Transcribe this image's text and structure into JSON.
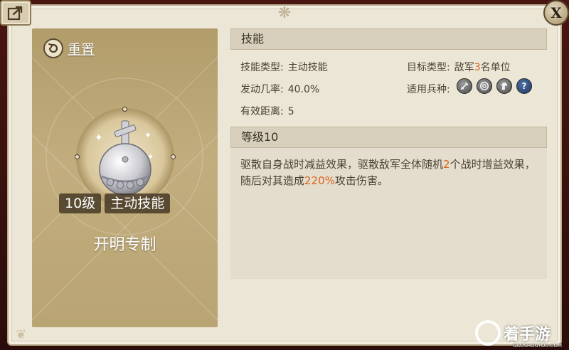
{
  "left_card": {
    "reset_label": "重置",
    "level_tag": "10级",
    "type_tag": "主动技能",
    "exclusive_text": "开明专制"
  },
  "skill_section": {
    "header": "技能",
    "skill_type_label": "技能类型:",
    "skill_type_value": "主动技能",
    "target_type_label": "目标类型:",
    "target_type_prefix": "敌军",
    "target_type_number": "3",
    "target_type_suffix": "名单位",
    "trigger_rate_label": "发动几率:",
    "trigger_rate_value": "40.0%",
    "unit_types_label": "适用兵种:",
    "range_label": "有效距离:",
    "range_value": "5"
  },
  "level_section": {
    "header": "等级10",
    "desc_part1": "驱散自身战时减益效果，驱散敌军全体随机",
    "desc_number": "2",
    "desc_part2": "个战时增益效果，随后对其造成",
    "desc_percent": "220%",
    "desc_part3": "攻击伤害。"
  },
  "unit_icons": [
    "sword-icon",
    "bow-target-icon",
    "horse-icon",
    "question-icon"
  ],
  "watermark": {
    "text": "着手游",
    "sub": "GAOSHOUYOU.COM"
  },
  "colors": {
    "highlight": "#d9651f",
    "card": "#b9a473",
    "panel": "#ece6d6"
  }
}
